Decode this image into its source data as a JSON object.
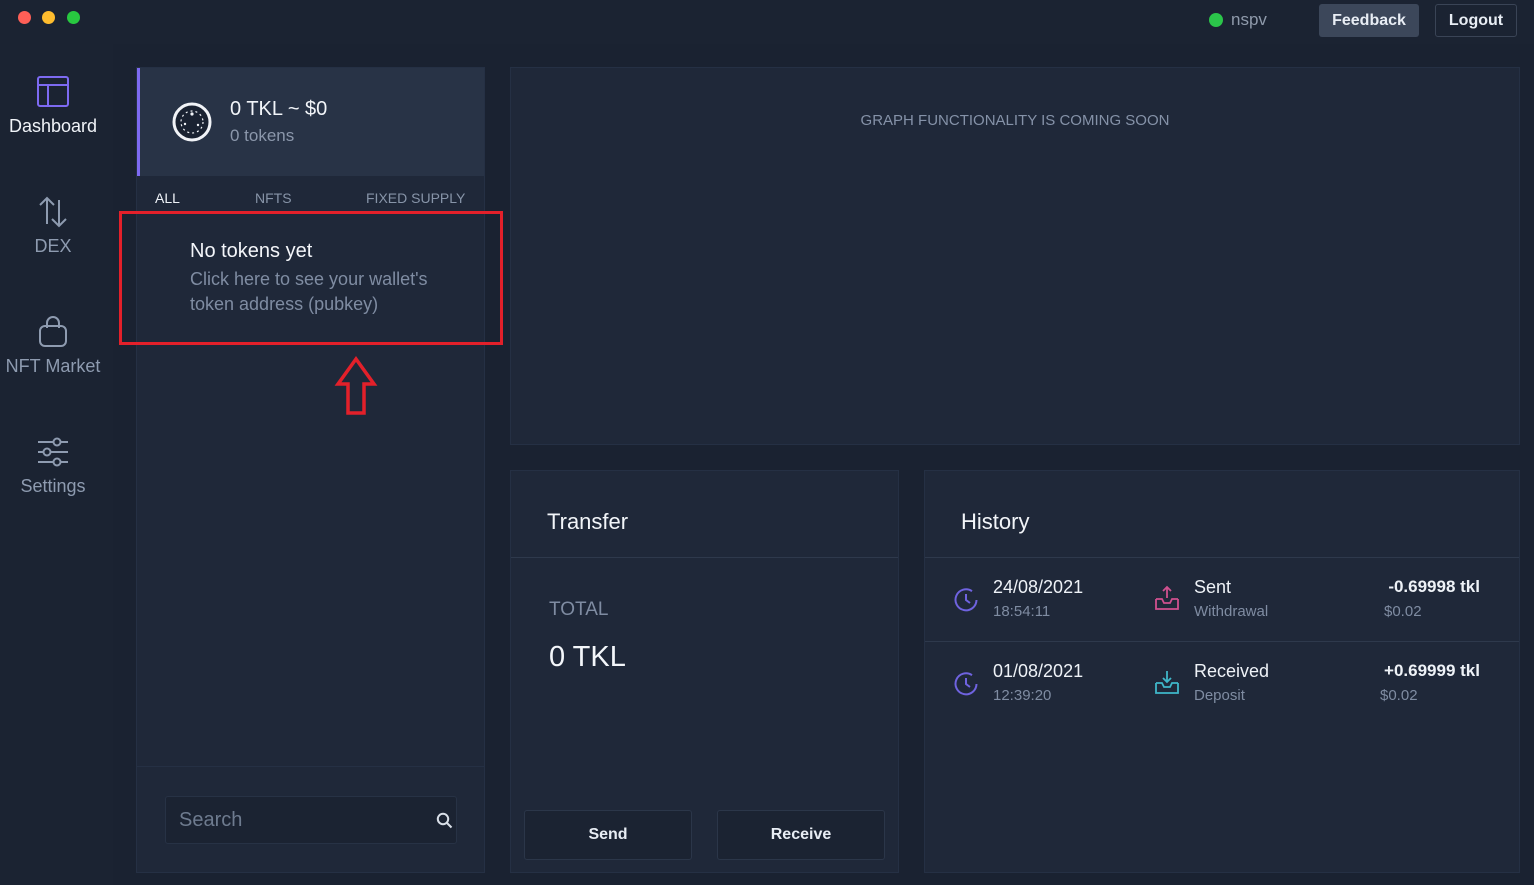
{
  "titlebar": {
    "network": "nspv",
    "feedback_label": "Feedback",
    "logout_label": "Logout",
    "network_status_color": "#2bc54a"
  },
  "sidebar": {
    "items": [
      {
        "label": "Dashboard",
        "icon": "dashboard-icon",
        "active": true
      },
      {
        "label": "DEX",
        "icon": "swap-arrows-icon",
        "active": false
      },
      {
        "label": "NFT Market",
        "icon": "shopping-bag-icon",
        "active": false
      },
      {
        "label": "Settings",
        "icon": "sliders-icon",
        "active": false
      }
    ]
  },
  "wallet": {
    "balance": "0 TKL ~ $0",
    "token_count": "0 tokens",
    "accent_color": "#7d6af2",
    "tabs": [
      "ALL",
      "NFTS",
      "FIXED SUPPLY"
    ],
    "active_tab": "ALL",
    "empty_title": "No tokens yet",
    "empty_subtitle": "Click here to see your wallet's token address (pubkey)",
    "search_placeholder": "Search"
  },
  "graph": {
    "message": "GRAPH FUNCTIONALITY IS COMING SOON"
  },
  "transfer": {
    "title": "Transfer",
    "total_label": "TOTAL",
    "total_value": "0 TKL",
    "send_label": "Send",
    "receive_label": "Receive"
  },
  "history": {
    "title": "History",
    "rows": [
      {
        "date": "24/08/2021",
        "time": "18:54:11",
        "type": "Sent",
        "subtype": "Withdrawal",
        "amount": "-0.69998 tkl",
        "usd": "$0.02",
        "icon": "outbox-icon"
      },
      {
        "date": "01/08/2021",
        "time": "12:39:20",
        "type": "Received",
        "subtype": "Deposit",
        "amount": "+0.69999 tkl",
        "usd": "$0.02",
        "icon": "inbox-icon"
      }
    ]
  },
  "annotation_color": "#e3202a"
}
